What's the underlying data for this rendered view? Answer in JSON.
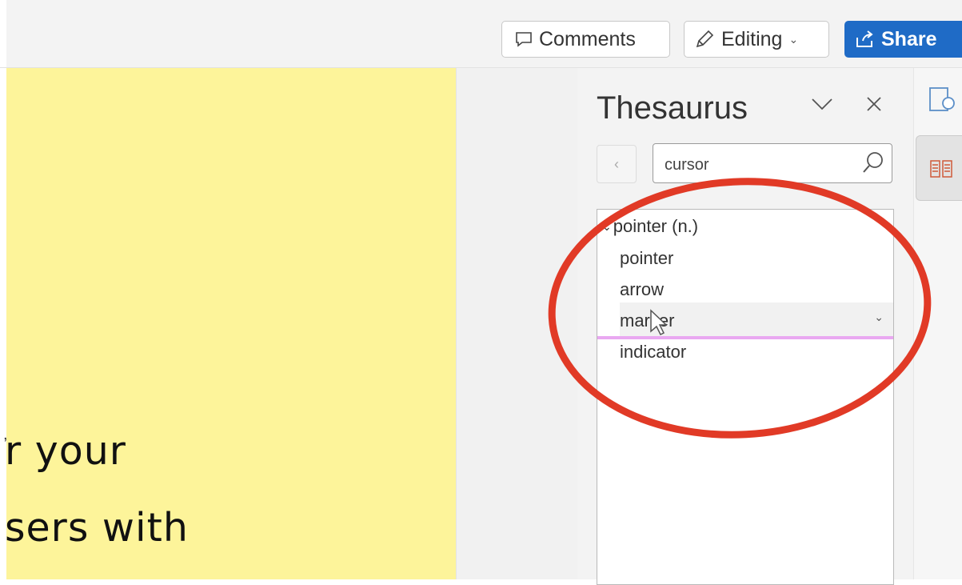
{
  "toolbar": {
    "comments_label": "Comments",
    "editing_label": "Editing",
    "share_label": "Share"
  },
  "document": {
    "line1": "r your",
    "line2": "sers with"
  },
  "thesaurus": {
    "title": "Thesaurus",
    "search_value": "cursor",
    "group_label": "pointer (n.)",
    "synonyms": [
      "pointer",
      "arrow",
      "marker",
      "indicator"
    ]
  },
  "colors": {
    "accent": "#1f6bc6",
    "document_bg": "#fdf49a",
    "annotation": "#e13a26",
    "focus_line": "#e9a8f1"
  },
  "icons": [
    "comment-icon",
    "pencil-icon",
    "share-icon",
    "chevron-down-icon",
    "close-icon",
    "back-arrow-icon",
    "search-icon",
    "cursor-icon",
    "book-icon",
    "research-icon"
  ]
}
